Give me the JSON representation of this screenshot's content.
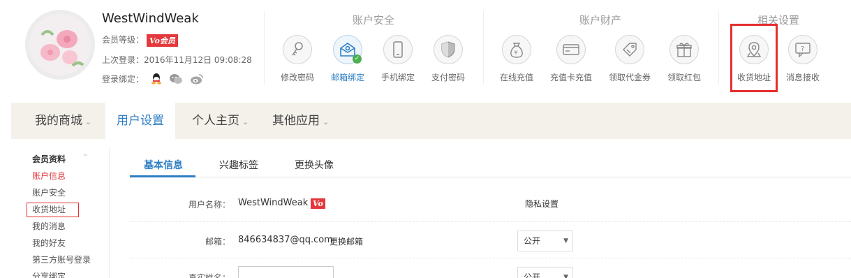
{
  "profile": {
    "username": "WestWindWeak",
    "level_label": "会员等级：",
    "vip_badge": "Vo会员",
    "last_login_label": "上次登录：",
    "last_login_time": "2016年11月12日 09:08:28",
    "bind_label": "登录绑定："
  },
  "groups": {
    "security": {
      "title": "账户安全",
      "items": [
        {
          "label": "修改密码",
          "icon": "key-icon"
        },
        {
          "label": "邮箱绑定",
          "icon": "email-icon",
          "active": true
        },
        {
          "label": "手机绑定",
          "icon": "phone-icon"
        },
        {
          "label": "支付密码",
          "icon": "shield-icon"
        }
      ]
    },
    "assets": {
      "title": "账户财产",
      "items": [
        {
          "label": "在线充值",
          "icon": "money-bag-icon"
        },
        {
          "label": "充值卡充值",
          "icon": "card-icon"
        },
        {
          "label": "领取代金券",
          "icon": "coupon-icon"
        },
        {
          "label": "领取红包",
          "icon": "gift-icon"
        }
      ]
    },
    "settings": {
      "title": "相关设置",
      "items": [
        {
          "label": "收货地址",
          "icon": "location-icon"
        },
        {
          "label": "消息接收",
          "icon": "message-icon"
        }
      ]
    }
  },
  "nav": {
    "items": [
      {
        "label": "我的商城"
      },
      {
        "label": "用户设置",
        "active": true
      },
      {
        "label": "个人主页"
      },
      {
        "label": "其他应用"
      }
    ]
  },
  "sidebar": {
    "heading": "会员资料",
    "items": [
      {
        "label": "账户信息",
        "active": true
      },
      {
        "label": "账户安全"
      },
      {
        "label": "收货地址"
      },
      {
        "label": "我的消息"
      },
      {
        "label": "我的好友"
      },
      {
        "label": "第三方账号登录"
      },
      {
        "label": "分享绑定"
      }
    ]
  },
  "tabs": [
    {
      "label": "基本信息",
      "active": true
    },
    {
      "label": "兴趣标签"
    },
    {
      "label": "更换头像"
    }
  ],
  "form": {
    "username_label": "用户名称：",
    "username_value": "WestWindWeak",
    "vo_badge": "Vo",
    "privacy_header": "隐私设置",
    "email_label": "邮箱：",
    "email_value": "846634837@qq.com",
    "change_email": "更换邮箱",
    "realname_label": "真实姓名：",
    "privacy_option": "公开"
  },
  "colors": {
    "accent": "#2e7ec4",
    "brand_red": "#e4393c",
    "nav_bg": "#f4f1ea"
  }
}
